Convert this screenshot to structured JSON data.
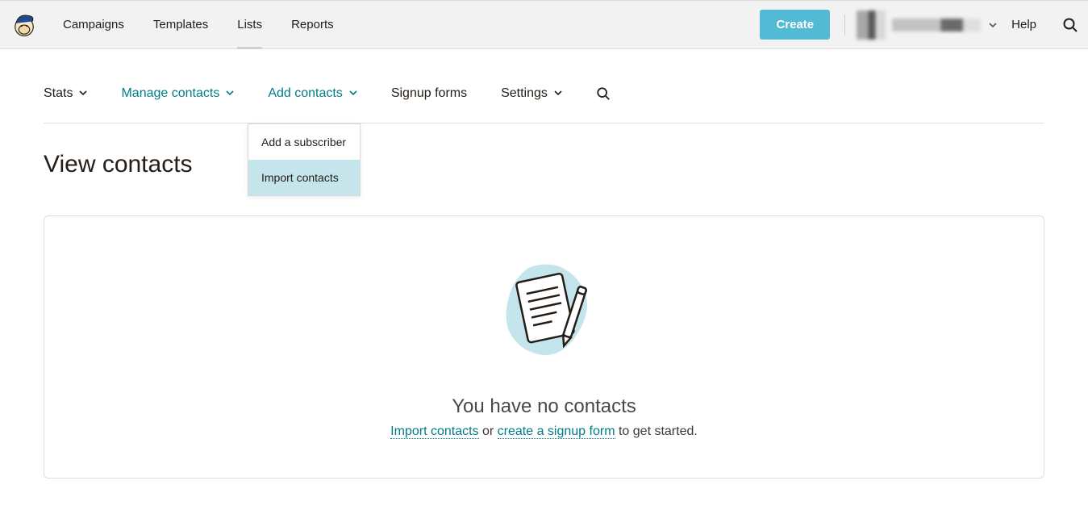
{
  "topnav": {
    "campaigns": "Campaigns",
    "templates": "Templates",
    "lists": "Lists",
    "reports": "Reports"
  },
  "header": {
    "create": "Create",
    "help": "Help"
  },
  "subnav": {
    "stats": "Stats",
    "manage_contacts": "Manage contacts",
    "add_contacts": "Add contacts",
    "signup_forms": "Signup forms",
    "settings": "Settings"
  },
  "dropdown": {
    "add_subscriber": "Add a subscriber",
    "import_contacts": "Import contacts"
  },
  "page": {
    "title": "View contacts"
  },
  "empty": {
    "title": "You have no contacts",
    "import_link": "Import contacts",
    "mid": " or ",
    "signup_link": "create a signup form",
    "tail": " to get started."
  }
}
